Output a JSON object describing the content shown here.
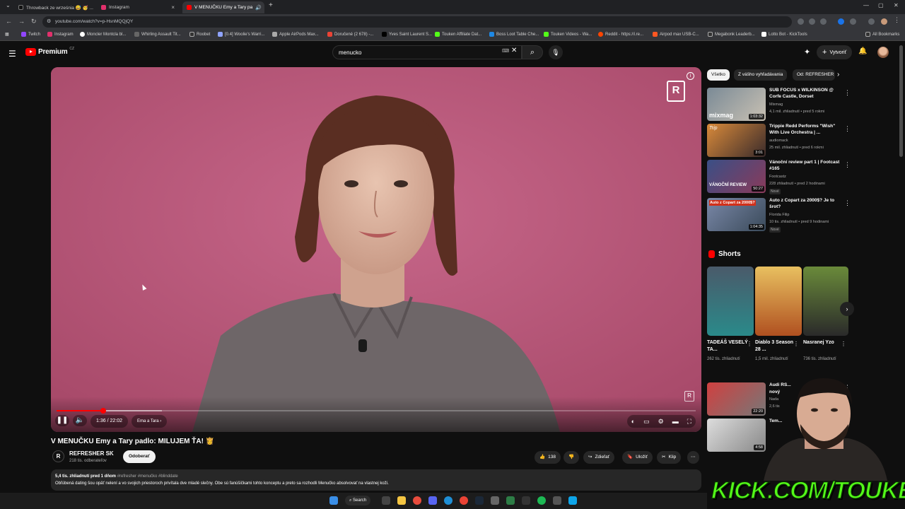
{
  "browser": {
    "tabs": [
      {
        "label": "Throwback ze września 😅 🥳 ...",
        "color": "#ffffff"
      },
      {
        "label": "Instagram",
        "color": "#e1306c"
      },
      {
        "label": "V MENUČKU Emy a Tary pa",
        "color": "#ff0000"
      }
    ],
    "new_tab": "+",
    "url": "youtube.com/watch?v=p-HsnMQQjQY",
    "bookmarks": [
      {
        "label": "Twitch",
        "color": "#9146ff"
      },
      {
        "label": "Instagram",
        "color": "#e1306c"
      },
      {
        "label": "Moncler Montcla bl...",
        "color": "#ffffff"
      },
      {
        "label": "Whirling Assault Tit...",
        "color": "#666666"
      },
      {
        "label": "Roobet",
        "color": "#f5c542"
      },
      {
        "label": "[0.4] Woolie's Warri...",
        "color": "#8fa3ff"
      },
      {
        "label": "Apple AirPods Max...",
        "color": "#aaaaaa"
      },
      {
        "label": "Doručené (2 678) -...",
        "color": "#ea4335"
      },
      {
        "label": "Yves Saint Laurent S...",
        "color": "#000000"
      },
      {
        "label": "Touken Affiliate Dat...",
        "color": "#53fc18"
      },
      {
        "label": "Boss Loot Table Che...",
        "color": "#1e88e5"
      },
      {
        "label": "Touken Videos - Wa...",
        "color": "#53fc18"
      },
      {
        "label": "Reddit - https://i.re...",
        "color": "#ff4500"
      },
      {
        "label": "Airpod max USB-C...",
        "color": "#ff5722"
      },
      {
        "label": "Megabonk Leaderb...",
        "color": "#666666"
      },
      {
        "label": "Lotto Bot - KickTools",
        "color": "#ffffff"
      }
    ],
    "all_bookmarks": "All Bookmarks"
  },
  "yt": {
    "logo_word": "Premium",
    "logo_cc": "CZ",
    "search_value": "menucko",
    "create_label": "Vytvoriť"
  },
  "player": {
    "time": "1:36 / 22:02",
    "chapter": "Ema a Tara",
    "progress": 0.0726,
    "buffered": 0.165,
    "watermark": "R"
  },
  "video": {
    "title": "V MENUČKU Emy a Tary padlo: MILUJEM ŤA! 👸",
    "channel": "REFRESHER SK",
    "channel_initial": "R",
    "subs": "218 tis. odberateľov",
    "subscribe": "Odoberať",
    "likes": "138",
    "share": "Zdieľať",
    "save": "Uložiť",
    "clip": "Klip",
    "desc_stats": "5,4 tis. zhliadnutí  pred 1 dňom",
    "desc_tags": "#refresher #menučko #blinddate",
    "desc_text": "Obľúbená dating šou opäť nelení a vo svojich priestoroch privítala dve mladé slečny. Obe sú fanúšičkami tohto konceptu a preto sa rozhodli Menučko absolvovať na vlastnej koži."
  },
  "sidebar": {
    "chips": [
      "Všetko",
      "Z vášho vyhľadávania",
      "Od: REFRESHER"
    ],
    "recs": [
      {
        "title": "SUB FOCUS x WILKINSON @ Corfe Castle, Dorset",
        "channel": "Mixmag",
        "meta": "4,1 mil. zhliadnutí • pred 5 rokmi",
        "duration": "1:03:32",
        "badge": "",
        "thumb_label": "mixmag"
      },
      {
        "title": "Trippie Redd Performs \"Wish\" With Live Orchestra | ...",
        "channel": "audiomack",
        "meta": "25 mil. zhliadnutí • pred 6 rokmi",
        "duration": "3:01",
        "badge": "",
        "thumb_label": "Trip"
      },
      {
        "title": "Vánoční review part 1 | Footcast #165",
        "channel": "Footcastz",
        "meta": "228 zhliadnutí • pred 2 hodinami",
        "duration": "50:27",
        "badge": "Nové",
        "thumb_label": "VÁNOČNÍ REVIEW"
      },
      {
        "title": "Auto z Copart za 2000$? Je to šrot?",
        "channel": "Florida Filip",
        "meta": "10 tis. zhliadnutí • pred 9 hodinami",
        "duration": "1:04:35",
        "badge": "Nové",
        "thumb_label": "Auto z Copart za 2000$?"
      }
    ],
    "shorts_title": "Shorts",
    "shorts": [
      {
        "title": "TADEÁŠ VESELÝ TA...",
        "views": "262 tis. zhliadnutí"
      },
      {
        "title": "Diablo 3 Season 28 ...",
        "views": "1,5 mil. zhliadnutí"
      },
      {
        "title": "Nasranej Yzo",
        "views": "736 tis. zhliadnutí"
      }
    ],
    "more_recs": [
      {
        "title": "Audi RS...",
        "sub": "nový",
        "channel": "Nada",
        "meta": "2,6 tis",
        "duration": "22:20"
      },
      {
        "title": "Tem...",
        "sub": "",
        "channel": "",
        "meta": "",
        "duration": "4:58"
      }
    ]
  },
  "overlay": {
    "kick_text": "KICK.COM/TOUKEN"
  },
  "taskbar": {
    "search": "Search"
  }
}
